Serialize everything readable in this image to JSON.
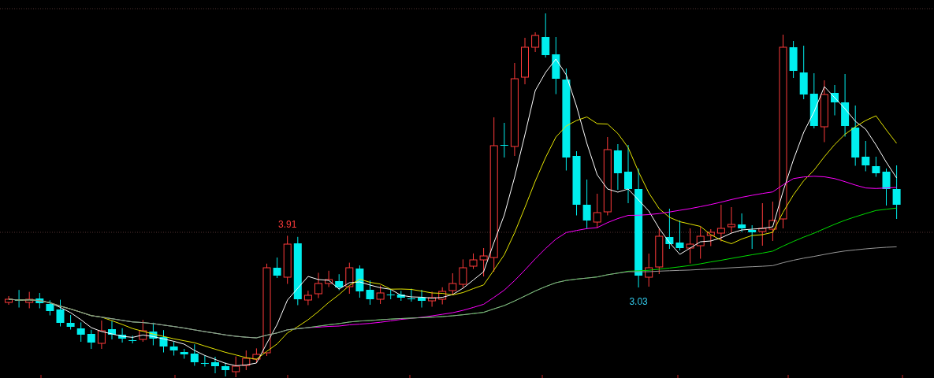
{
  "chart": {
    "price_markers": [
      {
        "kind": "high",
        "text": "3.91",
        "color": "#ff3b3b"
      },
      {
        "kind": "low",
        "text": "3.03",
        "color": "#33ccee"
      }
    ]
  }
}
